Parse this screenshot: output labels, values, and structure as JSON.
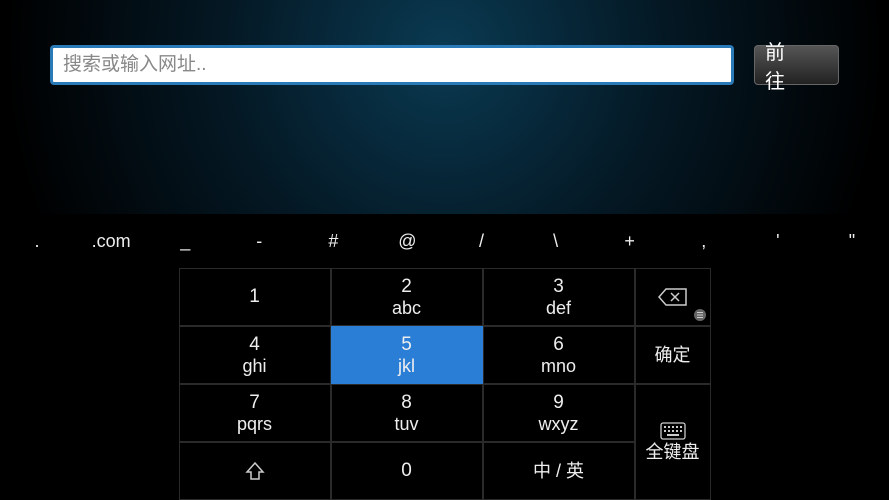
{
  "input": {
    "placeholder": "搜索或输入网址..",
    "value": ""
  },
  "go_button": "前 往",
  "symbol_row": [
    ".",
    ".com",
    "_",
    "-",
    "#",
    "@",
    "/",
    "\\",
    "+",
    ",",
    "'",
    "\""
  ],
  "num_keys": [
    {
      "digit": "1",
      "letters": ""
    },
    {
      "digit": "2",
      "letters": "abc"
    },
    {
      "digit": "3",
      "letters": "def"
    },
    {
      "digit": "4",
      "letters": "ghi"
    },
    {
      "digit": "5",
      "letters": "jkl",
      "selected": true
    },
    {
      "digit": "6",
      "letters": "mno"
    },
    {
      "digit": "7",
      "letters": "pqrs"
    },
    {
      "digit": "8",
      "letters": "tuv"
    },
    {
      "digit": "9",
      "letters": "wxyz"
    },
    {
      "digit": "",
      "letters": ""
    },
    {
      "digit": "0",
      "letters": ""
    },
    {
      "digit": "",
      "letters": "中 / 英"
    }
  ],
  "side_keys": {
    "confirm": "确定",
    "full_keyboard": "全键盘"
  }
}
